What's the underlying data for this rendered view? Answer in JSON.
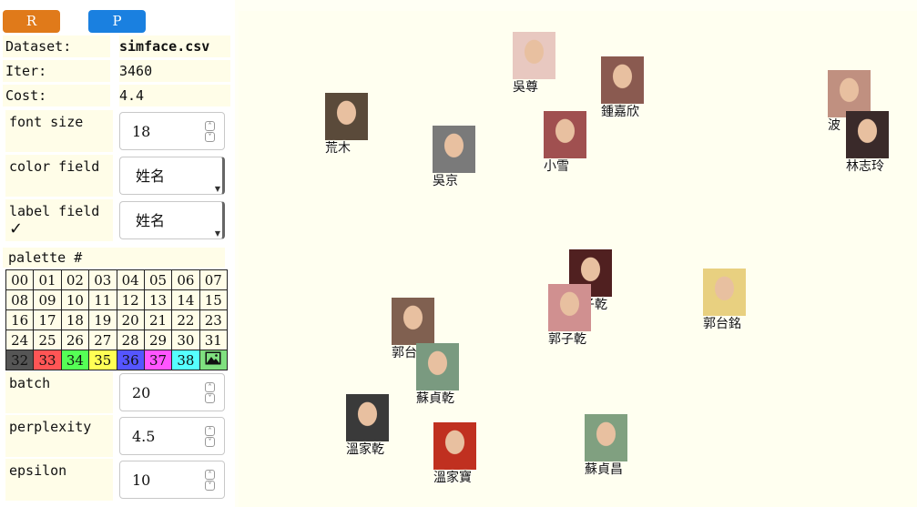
{
  "toolbar": {
    "r_label": "R",
    "p_label": "P"
  },
  "info": {
    "dataset_label": "Dataset:",
    "dataset_value": "simface.csv",
    "iter_label": "Iter:",
    "iter_value": "3460",
    "cost_label": "Cost:",
    "cost_value": "4.4"
  },
  "controls": {
    "font_size_label": "font size",
    "font_size_value": "18",
    "color_field_label": "color field",
    "color_field_value": "姓名",
    "label_field_label": "label field",
    "label_field_value": "姓名",
    "label_field_check": "✓",
    "palette_label": "palette #",
    "batch_label": "batch",
    "batch_value": "20",
    "perplexity_label": "perplexity",
    "perplexity_value": "4.5",
    "epsilon_label": "epsilon",
    "epsilon_value": "10"
  },
  "palette": {
    "rows": [
      [
        "00",
        "01",
        "02",
        "03",
        "04",
        "05",
        "06",
        "07"
      ],
      [
        "08",
        "09",
        "10",
        "11",
        "12",
        "13",
        "14",
        "15"
      ],
      [
        "16",
        "17",
        "18",
        "19",
        "20",
        "21",
        "22",
        "23"
      ],
      [
        "24",
        "25",
        "26",
        "27",
        "28",
        "29",
        "30",
        "31"
      ]
    ],
    "colored": [
      {
        "label": "32",
        "color": "#555555"
      },
      {
        "label": "33",
        "color": "#ff5555"
      },
      {
        "label": "34",
        "color": "#55ff55"
      },
      {
        "label": "35",
        "color": "#ffff55"
      },
      {
        "label": "36",
        "color": "#5555ff"
      },
      {
        "label": "37",
        "color": "#ff55ff"
      },
      {
        "label": "38",
        "color": "#55ffff"
      }
    ],
    "image_cell_color": "#7fe07f",
    "image_icon": "image-icon"
  },
  "points": [
    {
      "name": "吳尊",
      "color": "#e8c8c0"
    },
    {
      "name": "鍾嘉欣",
      "color": "#8a5a50"
    },
    {
      "name": "荒木",
      "color": "#5a4a3a"
    },
    {
      "name": "吳京",
      "color": "#7a7a7a"
    },
    {
      "name": "小雪",
      "color": "#a05050"
    },
    {
      "name": "波",
      "color": "#c09080"
    },
    {
      "name": "林志玲",
      "color": "#3a2a2a"
    },
    {
      "name": "郭子乾",
      "color": "#502020"
    },
    {
      "name": "郭子乾",
      "color": "#d09090"
    },
    {
      "name": "郭台銘",
      "color": "#e8d080"
    },
    {
      "name": "郭台",
      "color": "#806050"
    },
    {
      "name": "蘇貞乾",
      "color": "#7a9a80"
    },
    {
      "name": "溫家乾",
      "color": "#3a3a3a"
    },
    {
      "name": "溫家寶",
      "color": "#c03020"
    },
    {
      "name": "蘇貞昌",
      "color": "#80a080"
    }
  ]
}
